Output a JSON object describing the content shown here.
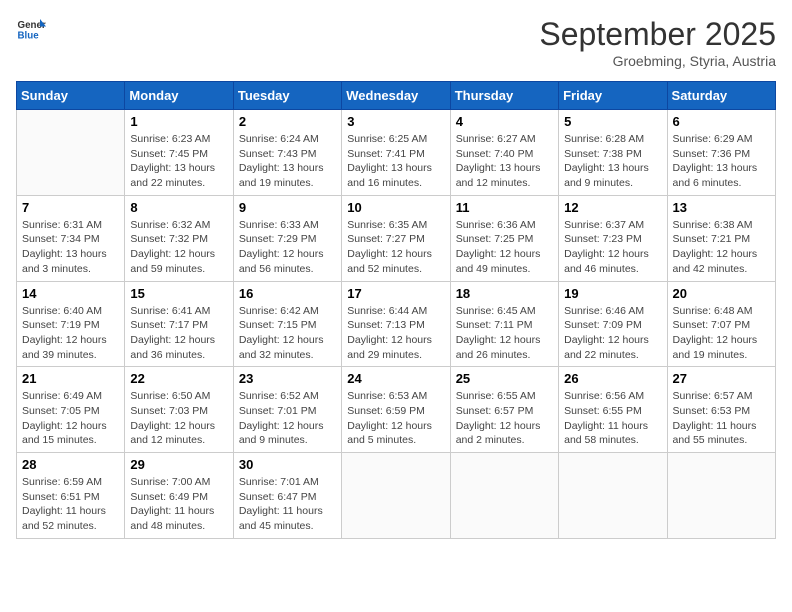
{
  "header": {
    "logo_general": "General",
    "logo_blue": "Blue",
    "month": "September 2025",
    "location": "Groebming, Styria, Austria"
  },
  "weekdays": [
    "Sunday",
    "Monday",
    "Tuesday",
    "Wednesday",
    "Thursday",
    "Friday",
    "Saturday"
  ],
  "weeks": [
    [
      {
        "date": "",
        "content": ""
      },
      {
        "date": "1",
        "content": "Sunrise: 6:23 AM\nSunset: 7:45 PM\nDaylight: 13 hours and 22 minutes."
      },
      {
        "date": "2",
        "content": "Sunrise: 6:24 AM\nSunset: 7:43 PM\nDaylight: 13 hours and 19 minutes."
      },
      {
        "date": "3",
        "content": "Sunrise: 6:25 AM\nSunset: 7:41 PM\nDaylight: 13 hours and 16 minutes."
      },
      {
        "date": "4",
        "content": "Sunrise: 6:27 AM\nSunset: 7:40 PM\nDaylight: 13 hours and 12 minutes."
      },
      {
        "date": "5",
        "content": "Sunrise: 6:28 AM\nSunset: 7:38 PM\nDaylight: 13 hours and 9 minutes."
      },
      {
        "date": "6",
        "content": "Sunrise: 6:29 AM\nSunset: 7:36 PM\nDaylight: 13 hours and 6 minutes."
      }
    ],
    [
      {
        "date": "7",
        "content": "Sunrise: 6:31 AM\nSunset: 7:34 PM\nDaylight: 13 hours and 3 minutes."
      },
      {
        "date": "8",
        "content": "Sunrise: 6:32 AM\nSunset: 7:32 PM\nDaylight: 12 hours and 59 minutes."
      },
      {
        "date": "9",
        "content": "Sunrise: 6:33 AM\nSunset: 7:29 PM\nDaylight: 12 hours and 56 minutes."
      },
      {
        "date": "10",
        "content": "Sunrise: 6:35 AM\nSunset: 7:27 PM\nDaylight: 12 hours and 52 minutes."
      },
      {
        "date": "11",
        "content": "Sunrise: 6:36 AM\nSunset: 7:25 PM\nDaylight: 12 hours and 49 minutes."
      },
      {
        "date": "12",
        "content": "Sunrise: 6:37 AM\nSunset: 7:23 PM\nDaylight: 12 hours and 46 minutes."
      },
      {
        "date": "13",
        "content": "Sunrise: 6:38 AM\nSunset: 7:21 PM\nDaylight: 12 hours and 42 minutes."
      }
    ],
    [
      {
        "date": "14",
        "content": "Sunrise: 6:40 AM\nSunset: 7:19 PM\nDaylight: 12 hours and 39 minutes."
      },
      {
        "date": "15",
        "content": "Sunrise: 6:41 AM\nSunset: 7:17 PM\nDaylight: 12 hours and 36 minutes."
      },
      {
        "date": "16",
        "content": "Sunrise: 6:42 AM\nSunset: 7:15 PM\nDaylight: 12 hours and 32 minutes."
      },
      {
        "date": "17",
        "content": "Sunrise: 6:44 AM\nSunset: 7:13 PM\nDaylight: 12 hours and 29 minutes."
      },
      {
        "date": "18",
        "content": "Sunrise: 6:45 AM\nSunset: 7:11 PM\nDaylight: 12 hours and 26 minutes."
      },
      {
        "date": "19",
        "content": "Sunrise: 6:46 AM\nSunset: 7:09 PM\nDaylight: 12 hours and 22 minutes."
      },
      {
        "date": "20",
        "content": "Sunrise: 6:48 AM\nSunset: 7:07 PM\nDaylight: 12 hours and 19 minutes."
      }
    ],
    [
      {
        "date": "21",
        "content": "Sunrise: 6:49 AM\nSunset: 7:05 PM\nDaylight: 12 hours and 15 minutes."
      },
      {
        "date": "22",
        "content": "Sunrise: 6:50 AM\nSunset: 7:03 PM\nDaylight: 12 hours and 12 minutes."
      },
      {
        "date": "23",
        "content": "Sunrise: 6:52 AM\nSunset: 7:01 PM\nDaylight: 12 hours and 9 minutes."
      },
      {
        "date": "24",
        "content": "Sunrise: 6:53 AM\nSunset: 6:59 PM\nDaylight: 12 hours and 5 minutes."
      },
      {
        "date": "25",
        "content": "Sunrise: 6:55 AM\nSunset: 6:57 PM\nDaylight: 12 hours and 2 minutes."
      },
      {
        "date": "26",
        "content": "Sunrise: 6:56 AM\nSunset: 6:55 PM\nDaylight: 11 hours and 58 minutes."
      },
      {
        "date": "27",
        "content": "Sunrise: 6:57 AM\nSunset: 6:53 PM\nDaylight: 11 hours and 55 minutes."
      }
    ],
    [
      {
        "date": "28",
        "content": "Sunrise: 6:59 AM\nSunset: 6:51 PM\nDaylight: 11 hours and 52 minutes."
      },
      {
        "date": "29",
        "content": "Sunrise: 7:00 AM\nSunset: 6:49 PM\nDaylight: 11 hours and 48 minutes."
      },
      {
        "date": "30",
        "content": "Sunrise: 7:01 AM\nSunset: 6:47 PM\nDaylight: 11 hours and 45 minutes."
      },
      {
        "date": "",
        "content": ""
      },
      {
        "date": "",
        "content": ""
      },
      {
        "date": "",
        "content": ""
      },
      {
        "date": "",
        "content": ""
      }
    ]
  ]
}
